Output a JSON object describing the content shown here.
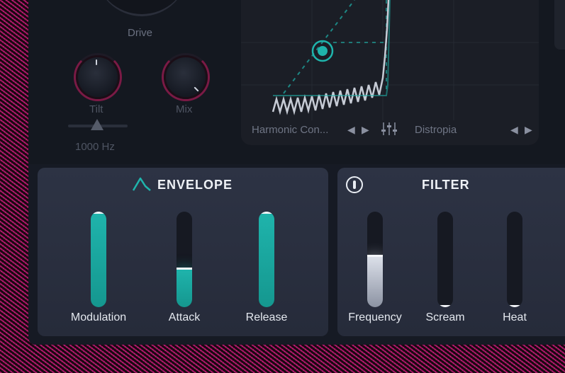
{
  "upper": {
    "drive_label": "Drive",
    "tilt_label": "Tilt",
    "mix_label": "Mix",
    "tilt_freq": "1000 Hz",
    "graph": {
      "left_preset": "Harmonic Con...",
      "right_preset": "Distropia"
    }
  },
  "envelope": {
    "title": "ENVELOPE",
    "sliders": [
      {
        "label": "Modulation",
        "value": 1.0
      },
      {
        "label": "Attack",
        "value": 0.4
      },
      {
        "label": "Release",
        "value": 1.0
      }
    ],
    "accent": "#1fb4ac"
  },
  "filter": {
    "title": "FILTER",
    "sliders": [
      {
        "label": "Frequency",
        "value": 0.55
      },
      {
        "label": "Scream",
        "value": 0.0
      },
      {
        "label": "Heat",
        "value": 0.0
      }
    ]
  }
}
